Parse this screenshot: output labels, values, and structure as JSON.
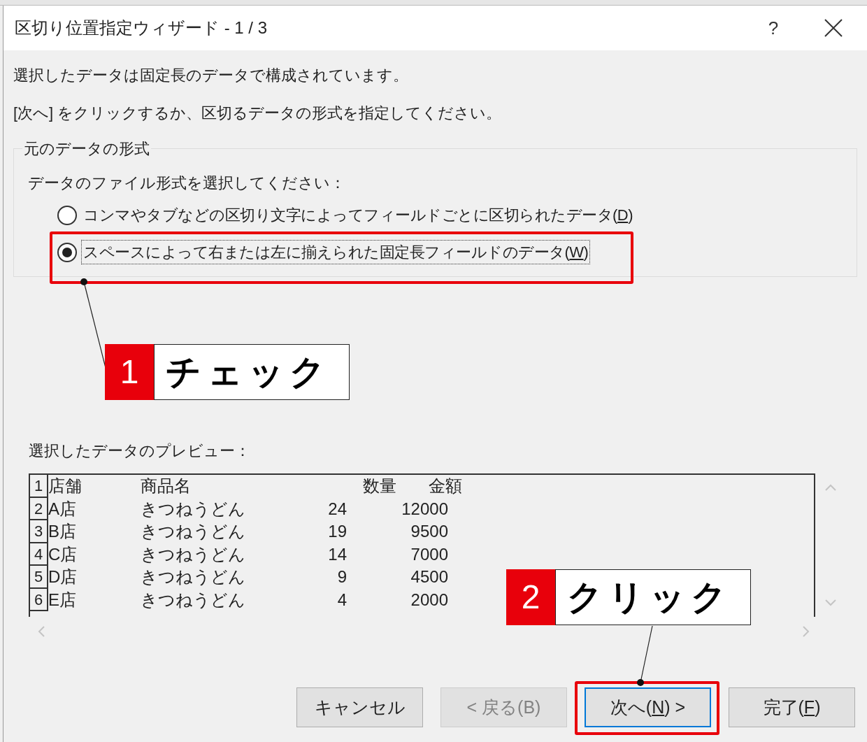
{
  "title_bar": {
    "title": "区切り位置指定ウィザード - 1 / 3",
    "help": "?"
  },
  "intro": [
    "選択したデータは固定長のデータで構成されています。",
    "[次へ] をクリックするか、区切るデータの形式を指定してください。"
  ],
  "group": {
    "legend": "元のデータの形式",
    "prompt": "データのファイル形式を選択してください：",
    "options": [
      {
        "before": "コンマやタブなどの区切り文字によってフィールドごとに区切られたデータ(",
        "mnemonic": "D",
        "after": ")",
        "selected": false
      },
      {
        "before": "スペースによって右または左に揃えられた固定長フィールドのデータ(",
        "mnemonic": "W",
        "after": ")",
        "selected": true
      }
    ]
  },
  "preview": {
    "label": "選択したデータのプレビュー：",
    "header": {
      "number": "1",
      "cells": [
        "店舗",
        "商品名",
        "数量",
        "金額"
      ]
    },
    "rows": [
      {
        "number": "2",
        "cells": [
          "A店",
          "きつねうどん",
          "24",
          "12000"
        ]
      },
      {
        "number": "3",
        "cells": [
          "B店",
          "きつねうどん",
          "19",
          "9500"
        ]
      },
      {
        "number": "4",
        "cells": [
          "C店",
          "きつねうどん",
          "14",
          "7000"
        ]
      },
      {
        "number": "5",
        "cells": [
          "D店",
          "きつねうどん",
          "9",
          "4500"
        ]
      },
      {
        "number": "6",
        "cells": [
          "E店",
          "きつねうどん",
          "4",
          "2000"
        ]
      }
    ]
  },
  "buttons": [
    {
      "before": "キャンセル",
      "disabled": false,
      "focused": false
    },
    {
      "before": "< 戻る(B)",
      "disabled": true,
      "focused": false
    },
    {
      "before": "次へ(",
      "mnemonic": "N",
      "after": ") >",
      "disabled": false,
      "focused": true
    },
    {
      "before": "完了(",
      "mnemonic": "F",
      "after": ")",
      "disabled": false,
      "focused": false
    }
  ],
  "annotations": [
    {
      "number": "1",
      "text": "チェック"
    },
    {
      "number": "2",
      "text": "クリック"
    }
  ]
}
